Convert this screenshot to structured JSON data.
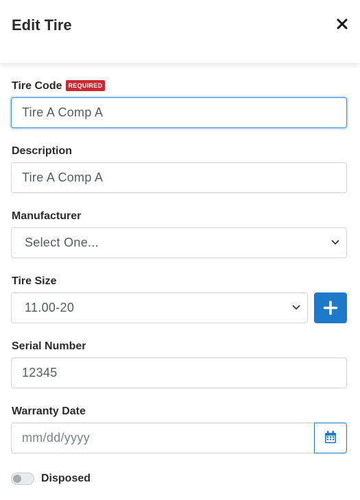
{
  "header": {
    "title": "Edit Tire",
    "close_icon": "close-icon"
  },
  "form": {
    "tire_code": {
      "label": "Tire Code",
      "badge": "REQUIRED",
      "value": "Tire A Comp A"
    },
    "description": {
      "label": "Description",
      "value": "Tire A Comp A"
    },
    "manufacturer": {
      "label": "Manufacturer",
      "selected": "Select One..."
    },
    "tire_size": {
      "label": "Tire Size",
      "selected": "11.00-20",
      "add_icon": "plus-icon"
    },
    "serial_number": {
      "label": "Serial Number",
      "value": "12345"
    },
    "warranty_date": {
      "label": "Warranty Date",
      "placeholder": "mm/dd/yyyy",
      "calendar_icon": "calendar-icon"
    },
    "disposed": {
      "label": "Disposed",
      "checked": false
    }
  },
  "colors": {
    "accent": "#1e79c8",
    "required_badge": "#c8282e",
    "focus_border": "#3a8fd6"
  }
}
